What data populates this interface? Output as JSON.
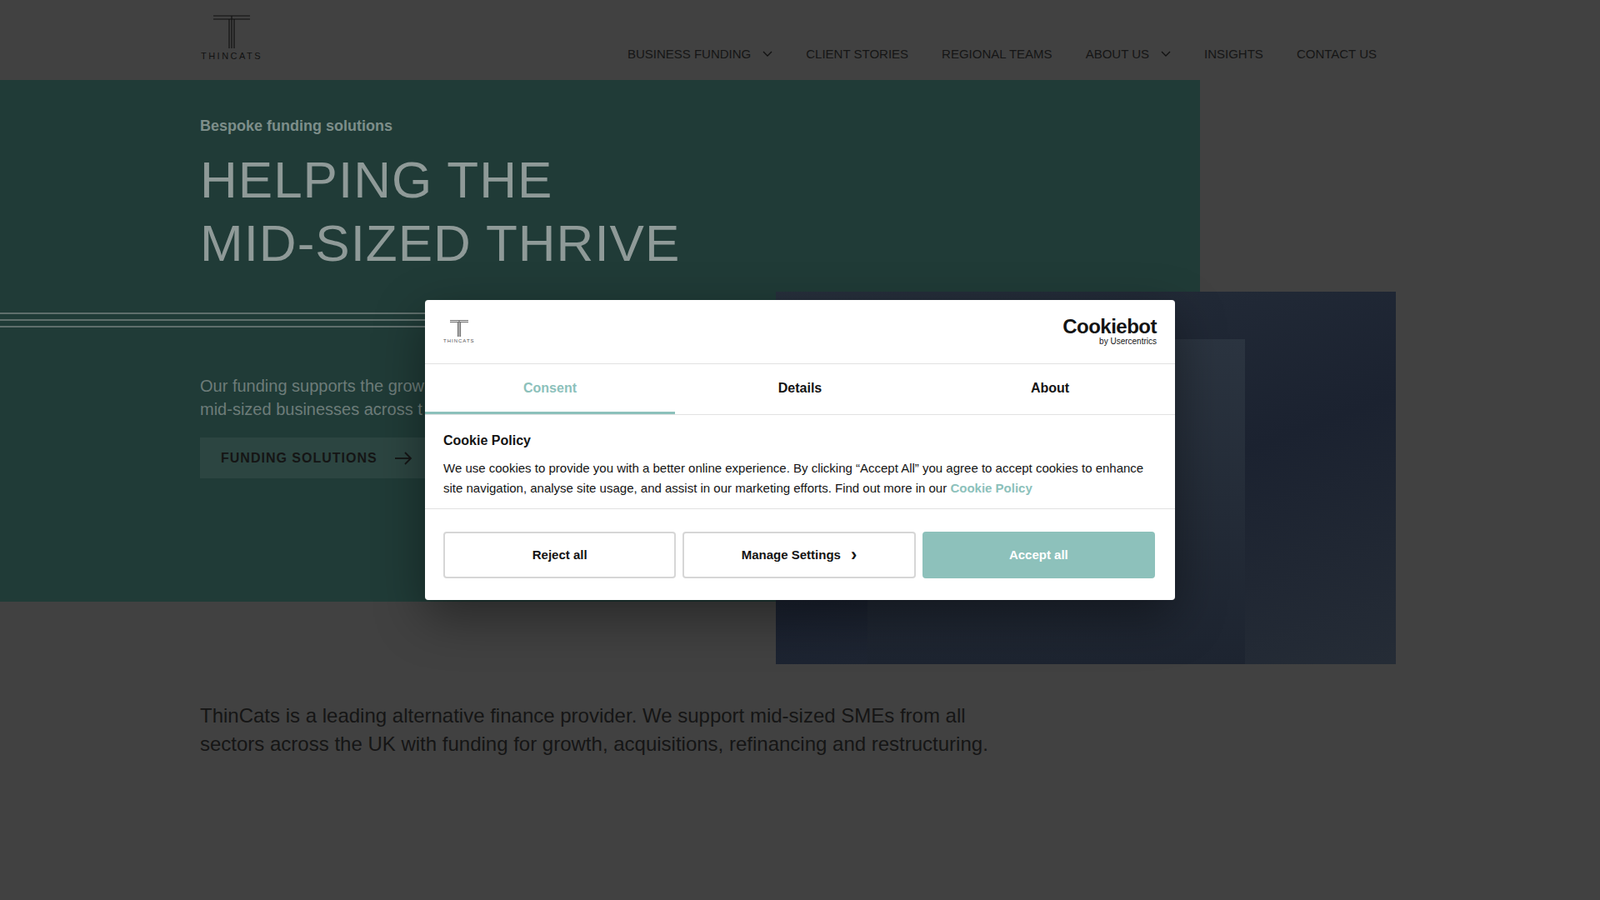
{
  "header": {
    "logo": "THINCATS",
    "nav": [
      {
        "label": "BUSINESS FUNDING",
        "dropdown": true
      },
      {
        "label": "CLIENT STORIES",
        "dropdown": false
      },
      {
        "label": "REGIONAL TEAMS",
        "dropdown": false
      },
      {
        "label": "ABOUT US",
        "dropdown": true
      },
      {
        "label": "INSIGHTS",
        "dropdown": false
      },
      {
        "label": "CONTACT US",
        "dropdown": false
      }
    ]
  },
  "hero": {
    "kicker": "Bespoke funding solutions",
    "heading": [
      "HELPING THE",
      "MID-SIZED THRIVE"
    ],
    "paragraph": [
      "Our funding supports the grow",
      "mid-sized businesses across t"
    ],
    "button": "FUNDING SOLUTIONS"
  },
  "intro": "ThinCats is a leading alternative finance provider. We support mid-sized SMEs from all sectors across the UK with funding for growth, acquisitions, refinancing and restructuring.",
  "cookie": {
    "logo": "THINCATS",
    "brand": "Cookiebot",
    "brand_sub": "by Usercentrics",
    "tabs": [
      {
        "label": "Consent",
        "selected": true
      },
      {
        "label": "Details",
        "selected": false
      },
      {
        "label": "About",
        "selected": false
      }
    ],
    "title": "Cookie Policy",
    "text": "We use cookies to provide you with a better online experience. By clicking “Accept All” you agree to accept cookies to enhance site navigation, analyse site usage, and assist in our marketing efforts. Find out more in our",
    "link": "Cookie Policy",
    "buttons": [
      {
        "label": "Reject all",
        "kind": "outline"
      },
      {
        "label": "Manage Settings",
        "kind": "settings",
        "icon": "›"
      },
      {
        "label": "Accept all",
        "kind": "primary"
      }
    ]
  }
}
